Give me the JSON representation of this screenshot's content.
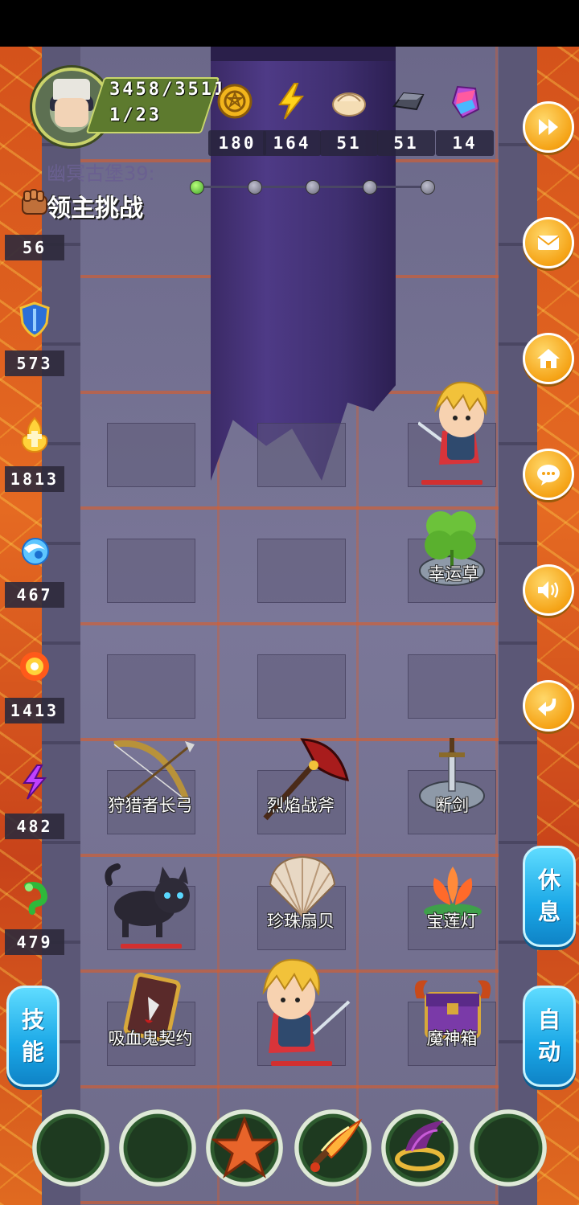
{
  "player": {
    "hp": "3458/3511",
    "floor_progress": "1/23"
  },
  "resources": [
    {
      "icon": "gold-coin-icon",
      "value": "180"
    },
    {
      "icon": "lightning-energy-icon",
      "value": "164"
    },
    {
      "icon": "dumpling-food-icon",
      "value": "51"
    },
    {
      "icon": "iron-ingot-icon",
      "value": "51"
    },
    {
      "icon": "purple-crystal-icon",
      "value": "14"
    }
  ],
  "level": {
    "name": "幽冥古堡39:",
    "mode": "领主挑战",
    "progress_dots": 5,
    "current_dot": 0
  },
  "stats": [
    {
      "icon": "fist-attack-icon",
      "value": "56"
    },
    {
      "icon": "shield-defense-icon",
      "value": "573"
    },
    {
      "icon": "holy-flame-icon",
      "value": "1813"
    },
    {
      "icon": "water-swirl-icon",
      "value": "467"
    },
    {
      "icon": "fire-burst-icon",
      "value": "1413"
    },
    {
      "icon": "purple-lightning-icon",
      "value": "482"
    },
    {
      "icon": "green-poison-icon",
      "value": "479"
    }
  ],
  "right_buttons": [
    {
      "icon": "fast-forward-icon"
    },
    {
      "icon": "mail-icon"
    },
    {
      "icon": "home-icon"
    },
    {
      "icon": "chat-icon"
    },
    {
      "icon": "sound-icon"
    },
    {
      "icon": "return-icon"
    }
  ],
  "side_buttons": {
    "rest": "休息",
    "skills": "技能",
    "auto": "自动"
  },
  "items": {
    "lucky_clover": "幸运草",
    "hunter_bow": "狩猎者长弓",
    "flame_axe": "烈焰战斧",
    "broken_sword": "断剑",
    "pearl_scallop": "珍珠扇贝",
    "lotus_lamp": "宝莲灯",
    "vampire_contract": "吸血鬼契约",
    "demon_box": "魔神箱"
  },
  "skill_slots": [
    {
      "icon": "empty-slot"
    },
    {
      "icon": "empty-slot"
    },
    {
      "icon": "starfish-skill-icon"
    },
    {
      "icon": "flame-sword-skill-icon"
    },
    {
      "icon": "feather-ring-skill-icon"
    },
    {
      "icon": "empty-slot"
    }
  ]
}
